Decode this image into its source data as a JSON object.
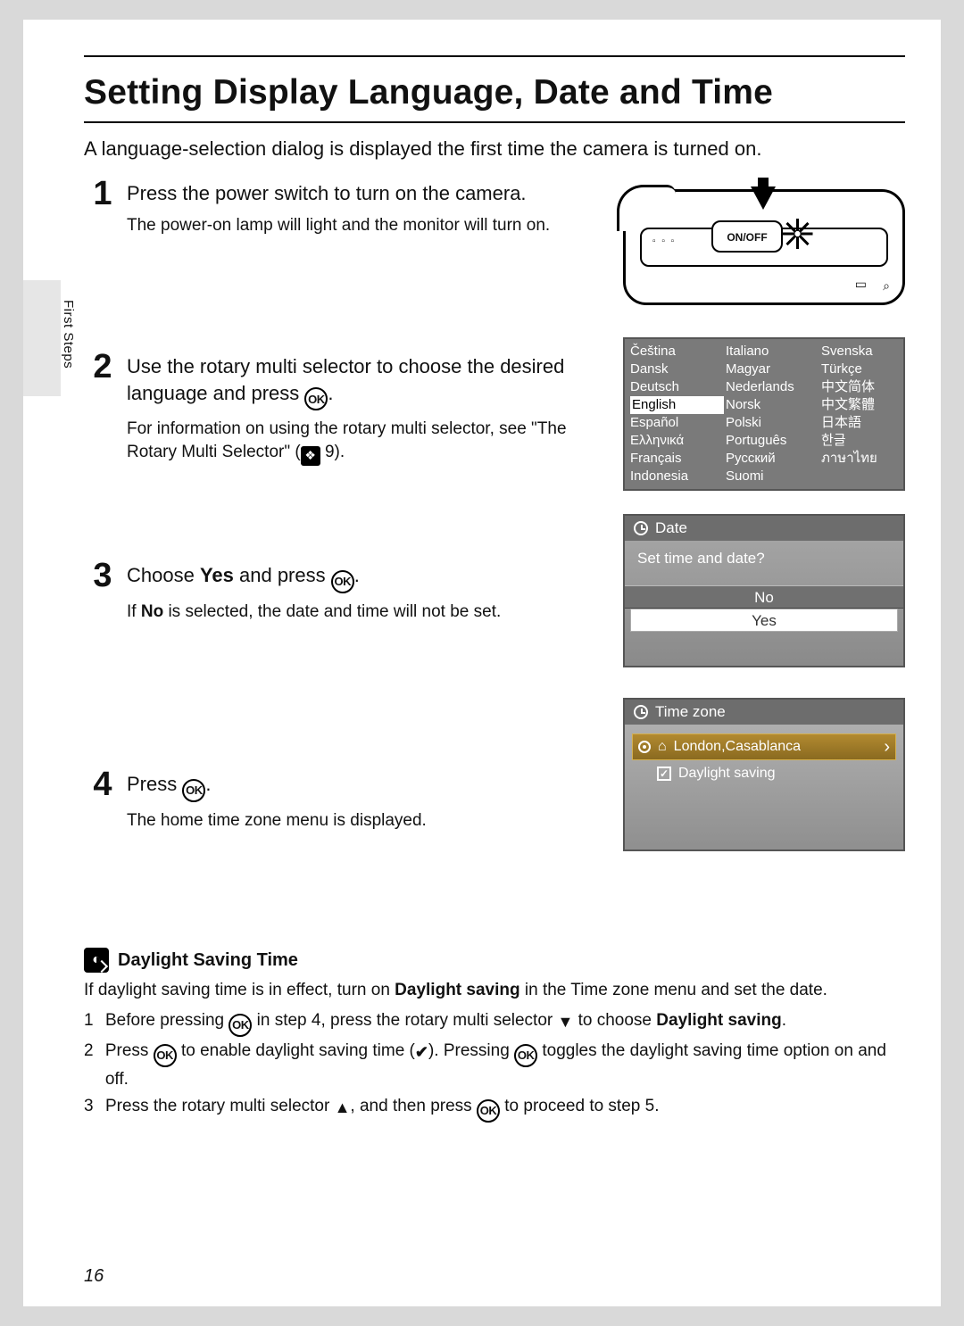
{
  "section_tab": "First Steps",
  "page_title": "Setting Display Language, Date and Time",
  "intro": "A language-selection dialog is displayed the first time the camera is turned on.",
  "ok_label": "OK",
  "steps": {
    "s1": {
      "num": "1",
      "head": "Press the power switch to turn on the camera.",
      "desc": "The power-on lamp will light and the monitor will turn on."
    },
    "s2": {
      "num": "2",
      "head_a": "Use the rotary multi selector to choose the desired language and press ",
      "head_b": ".",
      "desc_a": "For information on using the rotary multi selector, see \"The Rotary Multi Selector\" (",
      "desc_b": " 9)."
    },
    "s3": {
      "num": "3",
      "head_a": "Choose ",
      "head_bold": "Yes",
      "head_b": " and press ",
      "head_c": ".",
      "desc_a": "If ",
      "desc_bold": "No",
      "desc_b": " is selected, the date and time will not be set."
    },
    "s4": {
      "num": "4",
      "head_a": "Press ",
      "head_b": ".",
      "desc": "The home time zone menu is displayed."
    }
  },
  "camera": {
    "onoff": "ON/OFF"
  },
  "languages": {
    "col1": [
      "Čeština",
      "Dansk",
      "Deutsch",
      "English",
      "Español",
      "Ελληνικά",
      "Français",
      "Indonesia"
    ],
    "col2": [
      "Italiano",
      "Magyar",
      "Nederlands",
      "Norsk",
      "Polski",
      "Português",
      "Русский",
      "Suomi"
    ],
    "col3": [
      "Svenska",
      "Türkçe",
      "中文简体",
      "中文繁體",
      "日本語",
      "한글",
      "ภาษาไทย",
      ""
    ],
    "selected": "English"
  },
  "date_dialog": {
    "title": "Date",
    "question": "Set time and date?",
    "opt_no": "No",
    "opt_yes": "Yes"
  },
  "tz_dialog": {
    "title": "Time zone",
    "location": "London,Casablanca",
    "daylight": "Daylight saving"
  },
  "note": {
    "title": "Daylight Saving Time",
    "lead_a": "If daylight saving time is in effect, turn on ",
    "lead_bold": "Daylight saving",
    "lead_b": " in the Time zone menu and set the date.",
    "item1_a": "Before pressing ",
    "item1_b": " in step 4, press the rotary multi selector ",
    "item1_c": " to choose ",
    "item1_bold": "Daylight saving",
    "item1_d": ".",
    "item2_a": "Press ",
    "item2_b": " to enable daylight saving time (",
    "item2_c": "). Pressing ",
    "item2_d": " toggles the daylight saving time option on and off.",
    "item3_a": "Press the rotary multi selector ",
    "item3_b": ", and then press ",
    "item3_c": " to proceed to step 5."
  },
  "page_number": "16"
}
